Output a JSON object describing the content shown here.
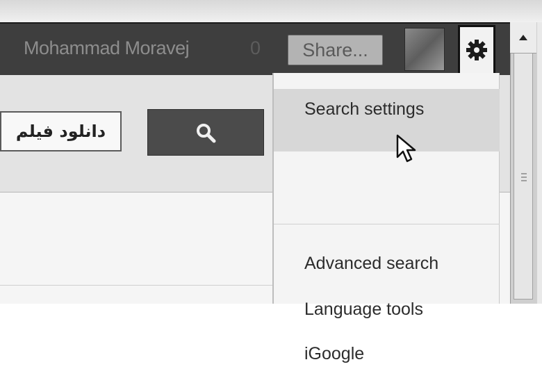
{
  "header": {
    "user_name": "Mohammad Moravej",
    "notification_count": "0",
    "share_label": "Share...",
    "avatar": "profile-photo",
    "settings_icon": "gear-icon"
  },
  "search": {
    "query": "دانلود فیلم",
    "button_icon": "magnifier-icon"
  },
  "settings_menu": {
    "items": [
      {
        "label": "Search settings"
      },
      {
        "label": "Advanced search"
      },
      {
        "label": "Language tools"
      },
      {
        "label": "iGoogle"
      }
    ]
  },
  "colors": {
    "topbar": "#3e3e3e",
    "menu_hover": "#d7d7d7",
    "search_button": "#4b4b4b"
  }
}
